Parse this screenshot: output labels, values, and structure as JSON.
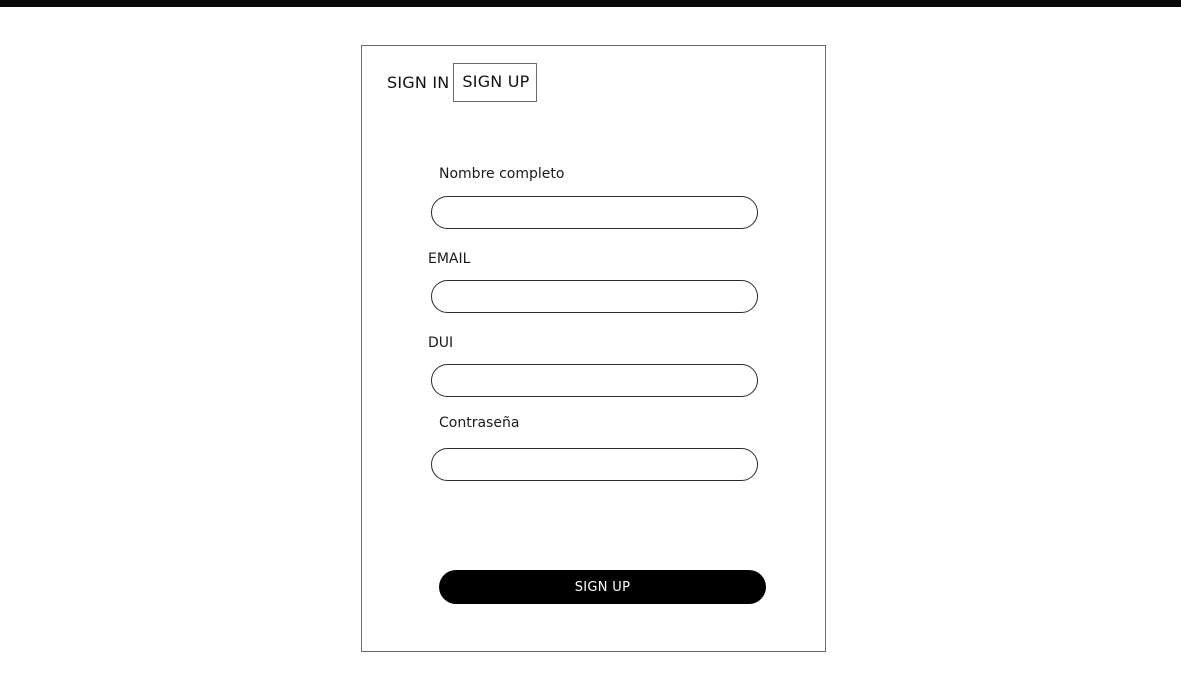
{
  "tabs": {
    "sign_in": "SIGN IN",
    "sign_up": "SIGN UP",
    "active": "sign_up"
  },
  "form": {
    "fields": [
      {
        "label": "Nombre completo",
        "value": "",
        "placeholder": ""
      },
      {
        "label": "EMAIL",
        "value": "",
        "placeholder": ""
      },
      {
        "label": "DUI",
        "value": "",
        "placeholder": ""
      },
      {
        "label": "Contraseña",
        "value": "",
        "placeholder": ""
      }
    ],
    "submit_label": "SIGN UP"
  },
  "colors": {
    "button_bg": "#000000",
    "button_text": "#ffffff",
    "border": "#2a2a2a",
    "top_bar": "#0a0a0a"
  }
}
